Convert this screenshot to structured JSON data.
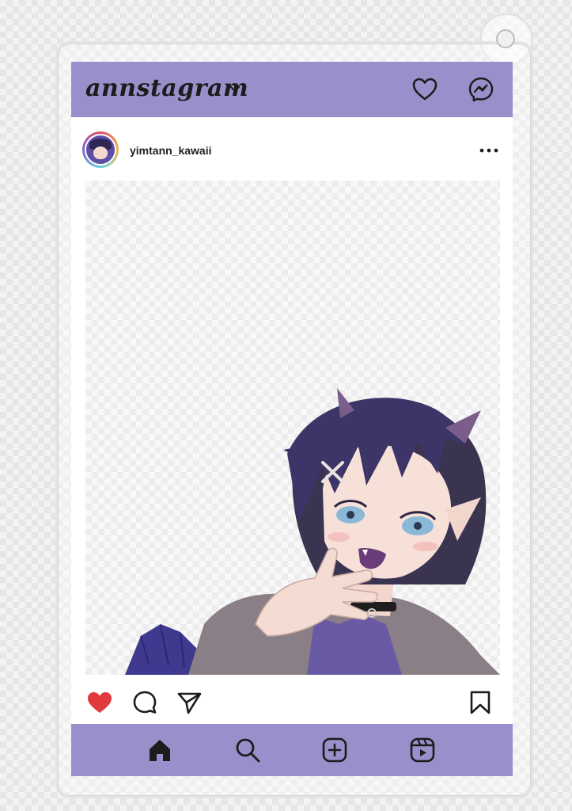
{
  "app": {
    "logo_text": "annstagram",
    "accent_color": "#9b8fcb",
    "icons": {
      "top_right": [
        "heart-icon",
        "messenger-icon"
      ],
      "logo_menu": "chevron-down-icon"
    }
  },
  "post": {
    "username": "yimtann_kawaii",
    "menu_icon": "more-options-icon",
    "liked": true,
    "like_color": "#e0393e",
    "actions": [
      "heart-icon",
      "comment-icon",
      "share-icon",
      "bookmark-icon"
    ]
  },
  "bottom_nav": {
    "items": [
      "home-icon",
      "search-icon",
      "add-post-icon",
      "reels-icon"
    ]
  }
}
